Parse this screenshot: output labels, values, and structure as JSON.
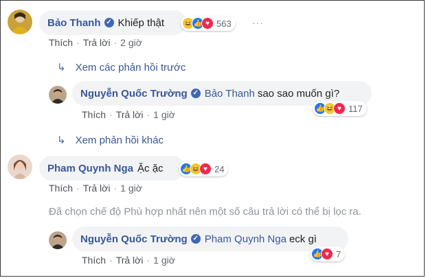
{
  "comments": [
    {
      "author": "Bảo Thanh",
      "text": "Khiếp thật",
      "reaction_count": "563",
      "actions": {
        "like": "Thích",
        "reply": "Trả lời",
        "time": "2 giờ"
      }
    },
    {
      "author": "Pham Quynh Nga",
      "text": "Ặc ặc",
      "reaction_count": "24",
      "actions": {
        "like": "Thích",
        "reply": "Trả lời",
        "time": "1 giờ"
      }
    }
  ],
  "replies": [
    {
      "author": "Nguyễn Quốc Trường",
      "mention": "Bảo Thanh",
      "text": "sao sao muốn gì?",
      "reaction_count": "117",
      "actions": {
        "like": "Thích",
        "reply": "Trả lời",
        "time": "1 giờ"
      }
    },
    {
      "author": "Nguyễn Quốc Trường",
      "mention": "Pham Quynh Nga",
      "text": "eck gì",
      "reaction_count": "7",
      "actions": {
        "like": "Thích",
        "reply": "Trả lời",
        "time": "1 giờ"
      }
    }
  ],
  "links": {
    "previous_replies": "Xem các phản hồi trước",
    "other_replies": "Xem phản hồi khác"
  },
  "notice": "Đã chọn chế độ Phù hợp nhất nên một số câu trả lời có thể bị lọc ra.",
  "more_label": "···",
  "colors": {
    "author": "#385898",
    "bubble": "#f2f3f5",
    "like": "#2078f4",
    "haha": "#f7c634",
    "love": "#f0284a"
  },
  "icons": [
    "verified-badge-icon",
    "reply-arrow-icon",
    "like-reaction-icon",
    "haha-reaction-icon",
    "love-reaction-icon",
    "more-options-icon"
  ]
}
